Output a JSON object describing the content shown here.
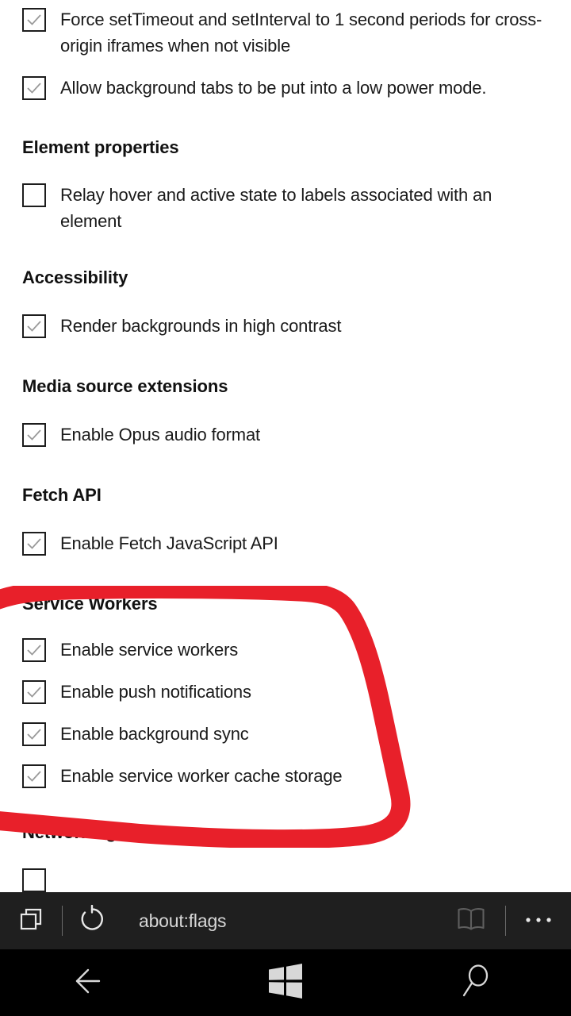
{
  "browser": {
    "url": "about:flags",
    "tabs_icon": "tabs-icon",
    "reload_icon": "reload-icon",
    "reading_view_icon": "book-icon",
    "more_icon": "ellipsis-icon"
  },
  "nav_bar": {
    "back_icon": "back-arrow-icon",
    "start_icon": "windows-logo-icon",
    "search_icon": "search-icon"
  },
  "annotation": {
    "color": "#e8202a",
    "shape": "hand-drawn-circle",
    "targets": "Service Workers"
  },
  "colors": {
    "page_background": "#ffffff",
    "text": "#1a1a1a",
    "heading": "#111111",
    "toolbar_background": "#1f1f1f",
    "navbar_background": "#000000",
    "annotation_red": "#e8202a",
    "checkbox_border": "#1d1d1d",
    "checkmark": "#9a9a9a"
  },
  "sections": [
    {
      "id": "top-partial",
      "heading": null,
      "options": [
        {
          "label": "Force setTimeout and setInterval to 1 second periods for cross-origin iframes when not visible",
          "checked": true
        },
        {
          "label": "Allow background tabs to be put into a low power mode.",
          "checked": true
        }
      ]
    },
    {
      "id": "element-properties",
      "heading": "Element properties",
      "options": [
        {
          "label": "Relay hover and active state to labels associated with an element",
          "checked": false
        }
      ]
    },
    {
      "id": "accessibility",
      "heading": "Accessibility",
      "options": [
        {
          "label": "Render backgrounds in high contrast",
          "checked": true
        }
      ]
    },
    {
      "id": "media-source-extensions",
      "heading": "Media source extensions",
      "options": [
        {
          "label": "Enable Opus audio format",
          "checked": true
        }
      ]
    },
    {
      "id": "fetch-api",
      "heading": "Fetch API",
      "options": [
        {
          "label": "Enable Fetch JavaScript API",
          "checked": true
        }
      ]
    },
    {
      "id": "service-workers",
      "heading": "Service Workers",
      "highlighted": true,
      "options": [
        {
          "label": "Enable service workers",
          "checked": true
        },
        {
          "label": "Enable push notifications",
          "checked": true
        },
        {
          "label": "Enable background sync",
          "checked": true
        },
        {
          "label": "Enable service worker cache storage",
          "checked": true
        }
      ]
    },
    {
      "id": "networking",
      "heading": "Networking",
      "options": [
        {
          "label": "",
          "checked": false,
          "clipped": true
        }
      ]
    }
  ]
}
